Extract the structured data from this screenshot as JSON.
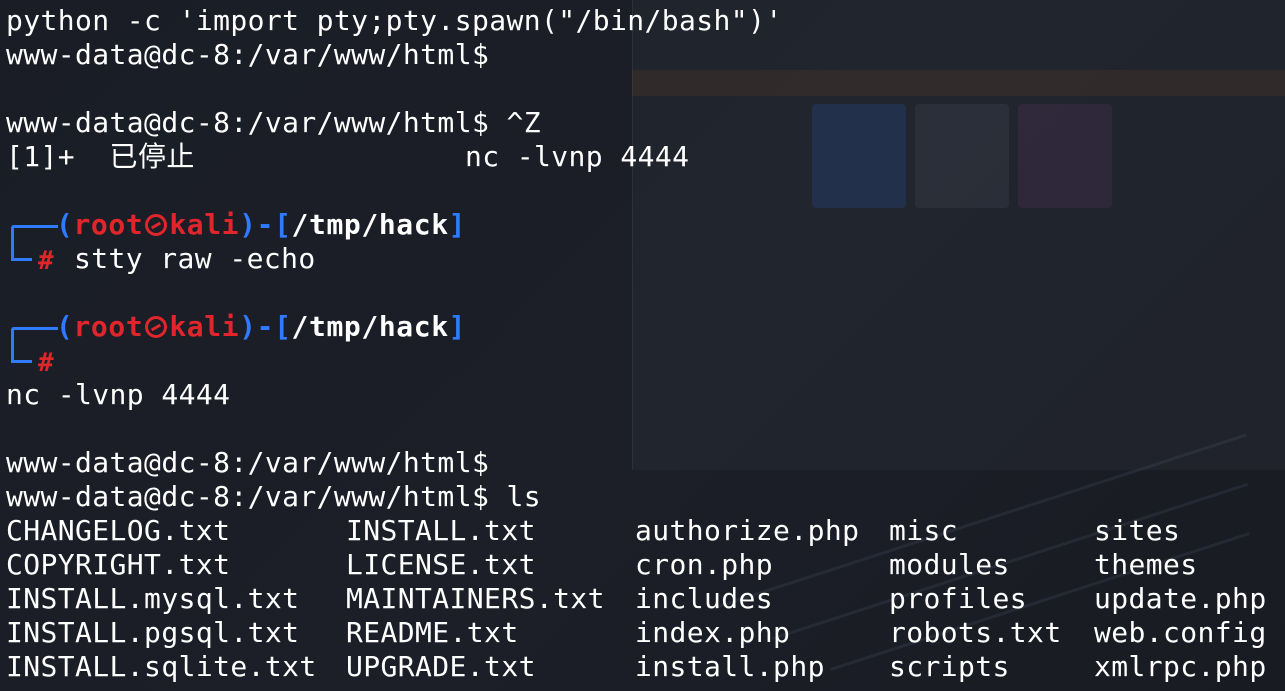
{
  "terminal": {
    "line_pty": "python -c 'import pty;pty.spawn(\"/bin/bash\")'",
    "line_prompt1": "www-data@dc-8:/var/www/html$",
    "line_prompt2": "www-data@dc-8:/var/www/html$ ^Z",
    "line_stopped_job": "[1]+  已停止",
    "line_stopped_cmd": "nc -lvnp 4444",
    "kali_prompt": {
      "user": "root",
      "host": "kali",
      "cwd": "/tmp/hack",
      "symbol": "#"
    },
    "cmd_stty": "stty raw -echo",
    "line_fg_cmd": "nc -lvnp 4444",
    "line_prompt3": "www-data@dc-8:/var/www/html$",
    "line_prompt_ls": "www-data@dc-8:/var/www/html$ ls",
    "ls_columns": [
      [
        "CHANGELOG.txt",
        "COPYRIGHT.txt",
        "INSTALL.mysql.txt",
        "INSTALL.pgsql.txt",
        "INSTALL.sqlite.txt"
      ],
      [
        "INSTALL.txt",
        "LICENSE.txt",
        "MAINTAINERS.txt",
        "README.txt",
        "UPGRADE.txt"
      ],
      [
        "authorize.php",
        "cron.php",
        "includes",
        "index.php",
        "install.php"
      ],
      [
        "misc",
        "modules",
        "profiles",
        "robots.txt",
        "scripts"
      ],
      [
        "sites",
        "themes",
        "update.php",
        "web.config",
        "xmlrpc.php"
      ]
    ]
  },
  "colors": {
    "background": "#1b1e26",
    "prompt_blue": "#2f7bff",
    "prompt_red": "#e0262a",
    "text": "#ffffff"
  }
}
